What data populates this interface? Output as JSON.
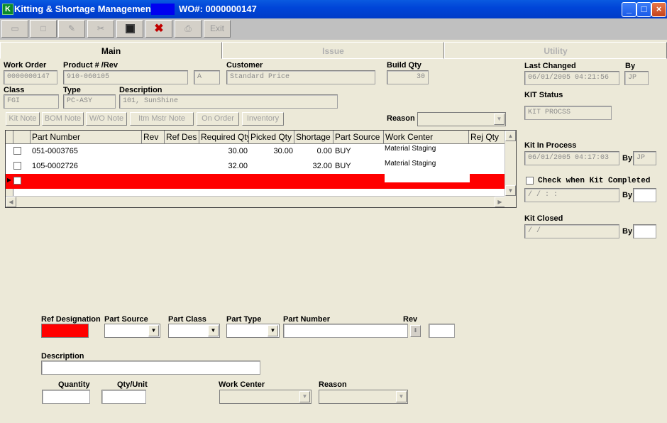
{
  "window": {
    "title": "Kitting & Shortage Management",
    "wo_title": "WO#: 0000000147",
    "controls": [
      "_",
      "□",
      "×"
    ]
  },
  "toolbar": {
    "buttons": [
      {
        "name": "open",
        "glyph": "▭"
      },
      {
        "name": "new",
        "glyph": "□"
      },
      {
        "name": "edit",
        "glyph": "✎"
      },
      {
        "name": "cut",
        "glyph": "✂"
      },
      {
        "name": "save",
        "glyph": "💾"
      },
      {
        "name": "delete",
        "glyph": "✖"
      },
      {
        "name": "print",
        "glyph": "⎙"
      },
      {
        "name": "exit",
        "label": "Exit"
      }
    ]
  },
  "tabs": [
    "Main",
    "Issue",
    "Utility"
  ],
  "header": {
    "work_order_label": "Work Order",
    "work_order": "0000000147",
    "product_label": "Product # /Rev",
    "product": "910-060105",
    "rev": "A",
    "customer_label": "Customer",
    "customer": "Standard Price",
    "build_qty_label": "Build Qty",
    "build_qty": "30",
    "class_label": "Class",
    "class": "FGI",
    "type_label": "Type",
    "type": "PC-ASY",
    "description_label": "Description",
    "description": "101, SunShine",
    "reason_label": "Reason"
  },
  "side": {
    "last_changed_label": "Last Changed",
    "last_changed": "06/01/2005 04:21:56",
    "by_label": "By",
    "by": "JP",
    "kit_status_label": "KIT Status",
    "kit_status": "KIT PROCSS",
    "kit_in_process_label": "Kit In Process",
    "kit_in_process": "06/01/2005 04:17:03",
    "kit_in_process_by": "JP",
    "check_completed_label": "Check when Kit Completed",
    "completed_date": "  /  /        :  :",
    "kit_closed_label": "Kit Closed",
    "kit_closed_date": "  /  /"
  },
  "action_buttons": [
    "Kit Note",
    "BOM Note",
    "W/O Note",
    "Itm Mstr Note",
    "On Order",
    "Inventory"
  ],
  "grid": {
    "columns": [
      "Part Number",
      "Rev",
      "Ref Des",
      "Required Qty",
      "Picked Qty",
      "Shortage",
      "Part Source",
      "Work Center",
      "Rej Qty"
    ],
    "rows": [
      {
        "part_number": "051-0003765",
        "rev": "",
        "ref_des": "",
        "required_qty": "30.00",
        "picked_qty": "30.00",
        "shortage": "0.00",
        "part_source": "BUY",
        "work_center": "Material Staging",
        "rej_qty": ""
      },
      {
        "part_number": "105-0002726",
        "rev": "",
        "ref_des": "",
        "required_qty": "32.00",
        "picked_qty": "",
        "shortage": "32.00",
        "part_source": "BUY",
        "work_center": "Material Staging",
        "rej_qty": ""
      }
    ],
    "new_row_color": "#ff0000"
  },
  "detail": {
    "ref_designation_label": "Ref Designation",
    "part_source_label": "Part Source",
    "part_class_label": "Part Class",
    "part_type_label": "Part Type",
    "part_number_label": "Part Number",
    "rev_label": "Rev",
    "description_label": "Description",
    "quantity_label": "Quantity",
    "qty_unit_label": "Qty/Unit",
    "work_center_label": "Work Center",
    "reason_label": "Reason"
  },
  "colors": {
    "titlebar": "#0045d8",
    "highlight_red": "#ff0000",
    "background": "#ece9d8"
  }
}
